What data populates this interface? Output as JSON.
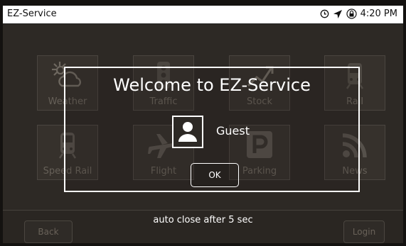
{
  "status_bar": {
    "app_title": "EZ-Service",
    "time": "4:20 PM",
    "icons": [
      "clock-icon",
      "location-arrow-icon",
      "lock-icon"
    ]
  },
  "tiles": [
    {
      "label": "Weather",
      "icon": "weather-icon"
    },
    {
      "label": "Traffic",
      "icon": "traffic-icon"
    },
    {
      "label": "Stock",
      "icon": "stock-icon"
    },
    {
      "label": "Rail",
      "icon": "rail-icon"
    },
    {
      "label": "Speed Rail",
      "icon": "speed-rail-icon"
    },
    {
      "label": "Flight",
      "icon": "flight-icon"
    },
    {
      "label": "Parking",
      "icon": "parking-icon"
    },
    {
      "label": "News",
      "icon": "news-icon"
    }
  ],
  "bottom_bar": {
    "back_label": "Back",
    "login_label": "Login",
    "auto_close_text": "auto close after 5 sec"
  },
  "dialog": {
    "title": "Welcome to EZ-Service",
    "user_label": "Guest",
    "ok_label": "OK"
  }
}
